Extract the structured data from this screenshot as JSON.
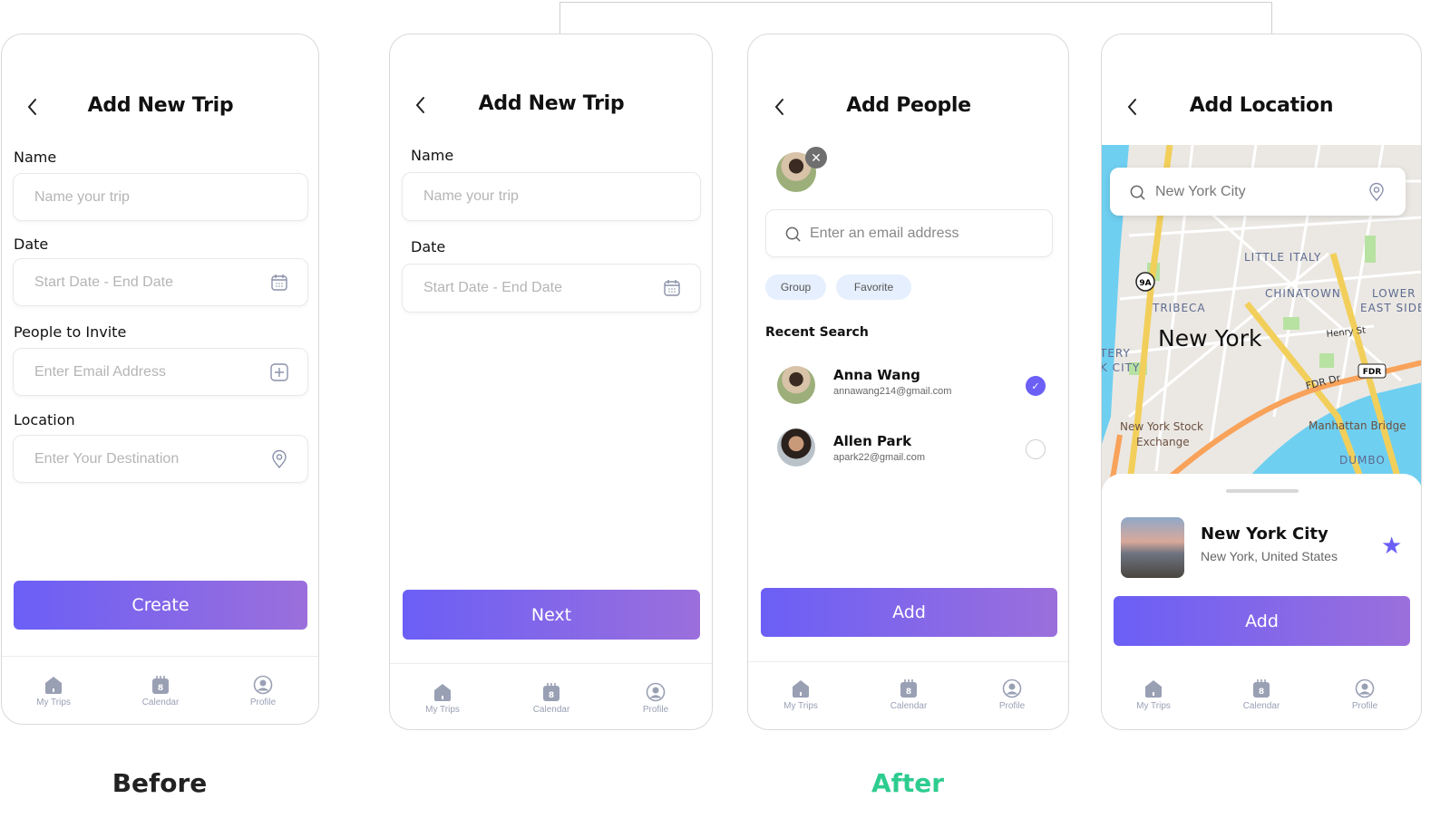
{
  "captions": {
    "before": "Before",
    "after": "After",
    "after_color": "#2ecc8f"
  },
  "colors": {
    "accent_start": "#6b5ff6",
    "accent_end": "#9b6fdc",
    "nav_icon": "#9aa0b4",
    "check": "#6b5ff6"
  },
  "nav": {
    "my_trips": "My Trips",
    "calendar": "Calendar",
    "calendar_day": "8",
    "profile": "Profile"
  },
  "before_screen": {
    "title": "Add New Trip",
    "name_label": "Name",
    "name_placeholder": "Name your trip",
    "date_label": "Date",
    "date_placeholder": "Start Date - End Date",
    "people_label": "People to Invite",
    "people_placeholder": "Enter Email Address",
    "location_label": "Location",
    "location_placeholder": "Enter Your Destination",
    "create_button": "Create"
  },
  "trip_screen": {
    "title": "Add New Trip",
    "name_label": "Name",
    "name_placeholder": "Name your trip",
    "date_label": "Date",
    "date_placeholder": "Start Date - End Date",
    "next_button": "Next"
  },
  "people_screen": {
    "title": "Add People",
    "search_placeholder": "Enter an email address",
    "chips": [
      "Group",
      "Favorite"
    ],
    "recent_label": "Recent Search",
    "people": [
      {
        "name": "Anna Wang",
        "email": "annawang214@gmail.com",
        "selected": true
      },
      {
        "name": "Allen Park",
        "email": "apark22@gmail.com",
        "selected": false
      }
    ],
    "add_button": "Add"
  },
  "location_screen": {
    "title": "Add Location",
    "search_value": "New York City",
    "map_labels": {
      "little_italy": "LITTLE ITALY",
      "chinatown": "CHINATOWN",
      "lower": "LOWER",
      "east_side": "EAST SIDE",
      "tribeca": "TRIBECA",
      "new_york": "New York",
      "henry": "Henry St",
      "fdr_dr": "FDR Dr",
      "fdr": "FDR",
      "route": "9A",
      "battery": "TERY",
      "battery2": "K CITY",
      "nyse": "New York Stock",
      "nyse2": "Exchange",
      "bridge": "Manhattan Bridge",
      "dumbo": "DUMBO"
    },
    "place_name": "New York City",
    "place_sub": "New York, United States",
    "add_button": "Add"
  }
}
